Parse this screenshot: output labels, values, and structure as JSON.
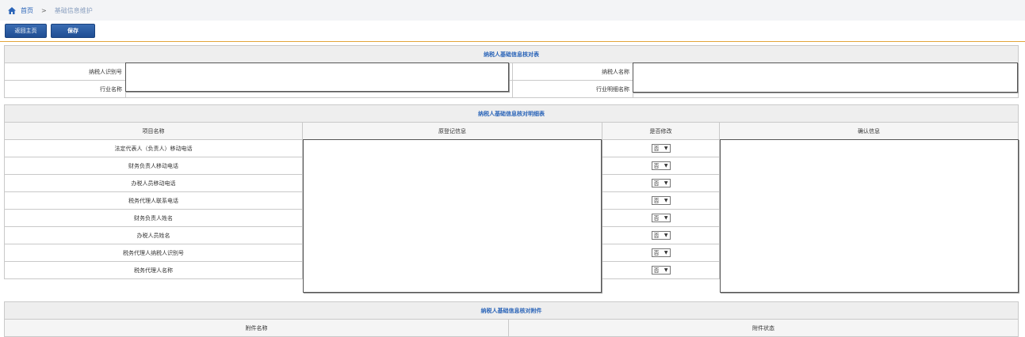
{
  "breadcrumb": {
    "home": "首页",
    "separator": ">",
    "current": "基础信息维护"
  },
  "toolbar": {
    "return_label": "返回主页",
    "save_label": "保存"
  },
  "table1": {
    "title": "纳税人基础信息核对表",
    "taxpayer_id_label": "纳税人识别号",
    "taxpayer_name_label": "纳税人名称",
    "industry_label": "行业名称",
    "industry_detail_label": "行业明细名称"
  },
  "table2": {
    "title": "纳税人基础信息核对明细表",
    "headers": [
      "项目名称",
      "原登记信息",
      "是否修改",
      "确认信息"
    ],
    "rows": [
      {
        "name": "法定代表人（负责人）移动电话",
        "modified": "否"
      },
      {
        "name": "财务负责人移动电话",
        "modified": "否"
      },
      {
        "name": "办税人员移动电话",
        "modified": "否"
      },
      {
        "name": "税务代理人联系电话",
        "modified": "否"
      },
      {
        "name": "财务负责人姓名",
        "modified": "否"
      },
      {
        "name": "办税人员姓名",
        "modified": "否"
      },
      {
        "name": "税务代理人纳税人识别号",
        "modified": "否"
      },
      {
        "name": "税务代理人名称",
        "modified": "否"
      }
    ]
  },
  "table3": {
    "title": "纳税人基础信息核对附件",
    "headers": [
      "附件名称",
      "附件状态"
    ]
  }
}
